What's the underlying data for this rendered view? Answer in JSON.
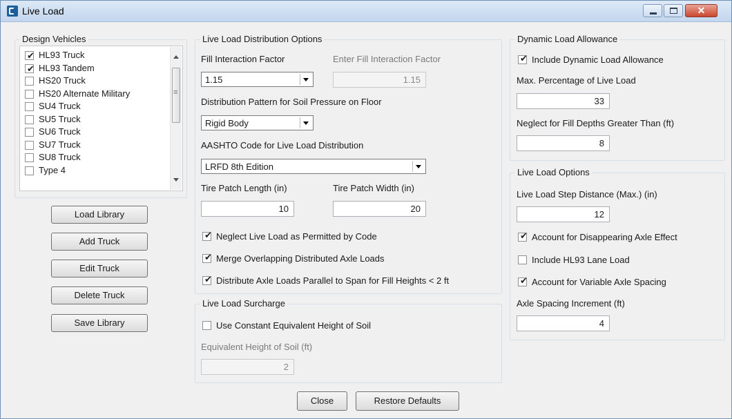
{
  "window": {
    "title": "Live Load"
  },
  "design_vehicles": {
    "legend": "Design Vehicles",
    "items": [
      {
        "label": "HL93 Truck",
        "checked": true
      },
      {
        "label": "HL93 Tandem",
        "checked": true
      },
      {
        "label": "HS20 Truck",
        "checked": false
      },
      {
        "label": "HS20 Alternate Military",
        "checked": false
      },
      {
        "label": "SU4 Truck",
        "checked": false
      },
      {
        "label": "SU5 Truck",
        "checked": false
      },
      {
        "label": "SU6 Truck",
        "checked": false
      },
      {
        "label": "SU7 Truck",
        "checked": false
      },
      {
        "label": "SU8 Truck",
        "checked": false
      },
      {
        "label": "Type 4",
        "checked": false
      }
    ]
  },
  "library_buttons": {
    "load_library": "Load Library",
    "add_truck": "Add Truck",
    "edit_truck": "Edit Truck",
    "delete_truck": "Delete Truck",
    "save_library": "Save Library"
  },
  "distribution": {
    "legend": "Live Load Distribution Options",
    "fill_interaction_label": "Fill Interaction Factor",
    "fill_interaction_value": "1.15",
    "enter_fill_label": "Enter Fill Interaction Factor",
    "enter_fill_value": "1.15",
    "pattern_label": "Distribution Pattern for Soil Pressure on Floor",
    "pattern_value": "Rigid Body",
    "aashto_label": "AASHTO Code for Live Load Distribution",
    "aashto_value": "LRFD 8th Edition",
    "tire_length_label": "Tire Patch Length (in)",
    "tire_length_value": "10",
    "tire_width_label": "Tire Patch Width (in)",
    "tire_width_value": "20",
    "neglect_label": "Neglect Live Load as Permitted by Code",
    "neglect_checked": true,
    "merge_label": "Merge Overlapping Distributed Axle Loads",
    "merge_checked": true,
    "distribute_label": "Distribute Axle Loads Parallel to Span for Fill Heights < 2 ft",
    "distribute_checked": true
  },
  "surcharge": {
    "legend": "Live Load Surcharge",
    "use_constant_label": "Use Constant Equivalent Height of Soil",
    "use_constant_checked": false,
    "height_label": "Equivalent Height of Soil (ft)",
    "height_value": "2"
  },
  "dynamic": {
    "legend": "Dynamic Load Allowance",
    "include_label": "Include Dynamic Load Allowance",
    "include_checked": true,
    "max_pct_label": "Max. Percentage of Live Load",
    "max_pct_value": "33",
    "neglect_fill_label": "Neglect for Fill Depths Greater Than (ft)",
    "neglect_fill_value": "8"
  },
  "options": {
    "legend": "Live Load Options",
    "step_label": "Live Load Step Distance (Max.) (in)",
    "step_value": "12",
    "disappearing_label": "Account for Disappearing Axle Effect",
    "disappearing_checked": true,
    "lane_label": "Include HL93 Lane Load",
    "lane_checked": false,
    "variable_label": "Account for Variable Axle Spacing",
    "variable_checked": true,
    "increment_label": "Axle Spacing Increment (ft)",
    "increment_value": "4"
  },
  "footer": {
    "close": "Close",
    "restore": "Restore Defaults"
  },
  "glyphs": {
    "check": "✔",
    "close": "✕"
  }
}
